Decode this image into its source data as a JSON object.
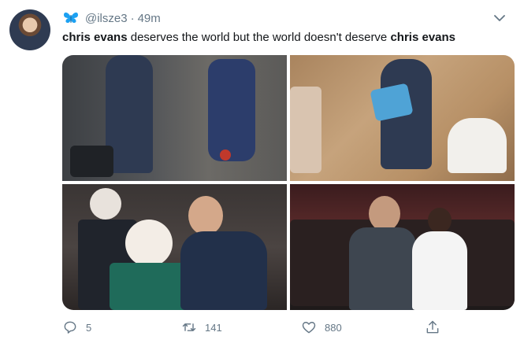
{
  "tweet": {
    "handle": "@ilsze3",
    "separator": "·",
    "time": "49m",
    "text_parts": [
      "chris evans",
      " deserves the world but the world doesn't deserve ",
      "chris evans"
    ],
    "photos": [
      {
        "name": "photo-1"
      },
      {
        "name": "photo-2"
      },
      {
        "name": "photo-3"
      },
      {
        "name": "photo-4"
      }
    ]
  },
  "actions": {
    "reply_count": "5",
    "retweet_count": "141",
    "like_count": "880"
  },
  "colors": {
    "brand_icon": "#1da1f2",
    "muted": "#657786"
  },
  "icons": [
    "butterfly-icon",
    "chevron-down-icon",
    "reply-icon",
    "retweet-icon",
    "like-icon",
    "share-icon"
  ]
}
